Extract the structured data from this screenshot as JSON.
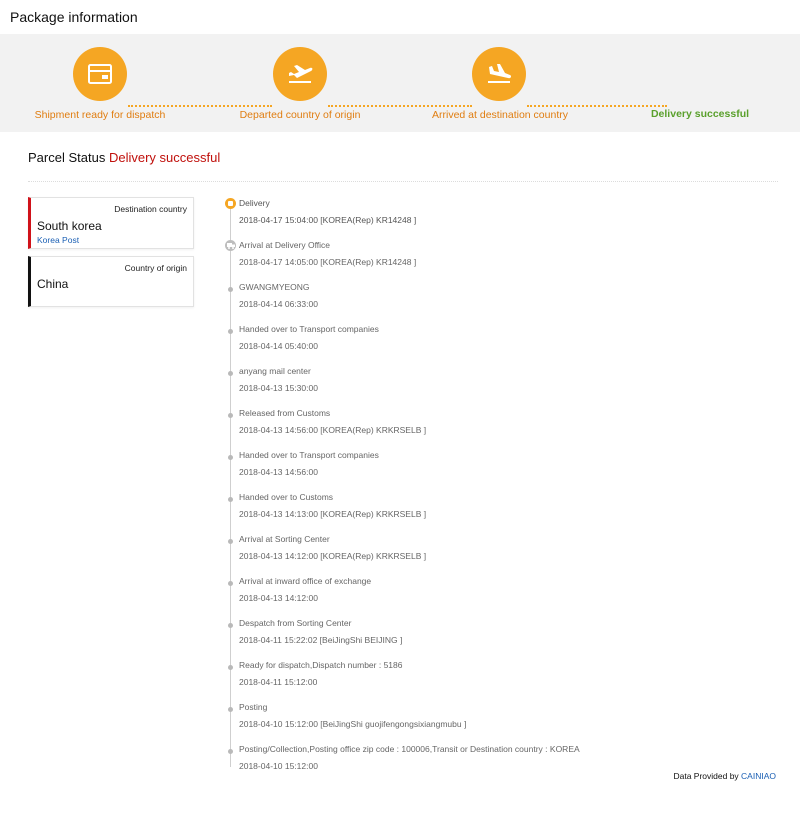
{
  "page_title": "Package information",
  "steps": [
    {
      "label": "Shipment ready for dispatch",
      "icon": "package-box-icon"
    },
    {
      "label": "Departed country of origin",
      "icon": "plane-takeoff-icon"
    },
    {
      "label": "Arrived at destination country",
      "icon": "plane-landing-icon"
    },
    {
      "label": "Delivery successful",
      "icon": ""
    }
  ],
  "parcel_status": {
    "label": "Parcel Status",
    "value": "Delivery successful"
  },
  "destination": {
    "caption": "Destination country",
    "name": "South korea",
    "postal": "Korea Post"
  },
  "origin": {
    "caption": "Country of origin",
    "name": "China"
  },
  "events": [
    {
      "title": "Delivery",
      "detail": "2018-04-17 15:04:00 [KOREA(Rep) KR14248 ]"
    },
    {
      "title": "Arrival at Delivery Office",
      "detail": "2018-04-17 14:05:00 [KOREA(Rep) KR14248 ]"
    },
    {
      "title": "GWANGMYEONG",
      "detail": "2018-04-14 06:33:00"
    },
    {
      "title": "Handed over to Transport companies",
      "detail": "2018-04-14 05:40:00"
    },
    {
      "title": "anyang mail center",
      "detail": "2018-04-13 15:30:00"
    },
    {
      "title": "Released from Customs",
      "detail": "2018-04-13 14:56:00 [KOREA(Rep) KRKRSELB ]"
    },
    {
      "title": "Handed over to Transport companies",
      "detail": "2018-04-13 14:56:00"
    },
    {
      "title": "Handed over to Customs",
      "detail": "2018-04-13 14:13:00 [KOREA(Rep) KRKRSELB ]"
    },
    {
      "title": "Arrival at Sorting Center",
      "detail": "2018-04-13 14:12:00 [KOREA(Rep) KRKRSELB ]"
    },
    {
      "title": "Arrival at inward office of exchange",
      "detail": "2018-04-13 14:12:00"
    },
    {
      "title": "Despatch from Sorting Center",
      "detail": "2018-04-11 15:22:02 [BeiJingShi BEIJING ]"
    },
    {
      "title": "Ready for dispatch,Dispatch number : 5186",
      "detail": "2018-04-11 15:12:00"
    },
    {
      "title": "Posting",
      "detail": "2018-04-10 15:12:00 [BeiJingShi guojifengongsixiangmubu ]"
    },
    {
      "title": "Posting/Collection,Posting office zip code : 100006,Transit or Destination country : KOREA",
      "detail": "2018-04-10 15:12:00"
    }
  ],
  "footer": {
    "prefix": "Data Provided by",
    "provider": "CAINIAO"
  },
  "colors": {
    "accent": "#f5a623",
    "success": "#5aa02c",
    "status_red": "#c0100c",
    "link": "#1a5fb4"
  }
}
